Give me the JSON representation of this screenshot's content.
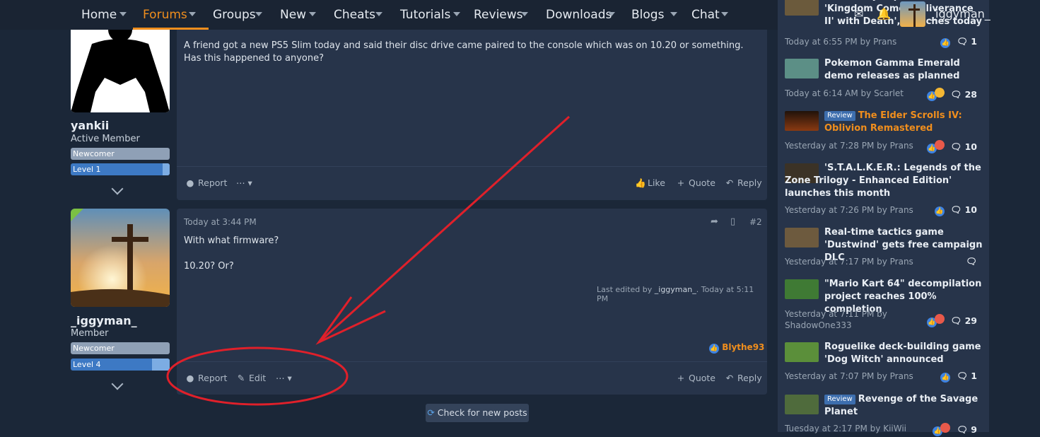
{
  "nav": {
    "items": [
      {
        "label": "Home"
      },
      {
        "label": "Forums"
      },
      {
        "label": "Groups"
      },
      {
        "label": "New"
      },
      {
        "label": "Cheats"
      },
      {
        "label": "Tutorials"
      },
      {
        "label": "Reviews"
      },
      {
        "label": "Downloads"
      },
      {
        "label": "Blogs"
      },
      {
        "label": "Chat"
      }
    ],
    "active": "Forums",
    "username": "_iggyman_"
  },
  "post1": {
    "author": {
      "name": "yankii",
      "title": "Active Member",
      "rank": "Newcomer",
      "level": "Level 1",
      "level_fill": 0.93
    },
    "text": "A friend got a new PS5 Slim today and said their disc drive came paired to the console which was on 10.20 or something. Has this happened to anyone?",
    "actions": {
      "report": "Report",
      "like": "Like",
      "quote": "Quote",
      "reply": "Reply"
    }
  },
  "post2": {
    "author": {
      "name": "_iggyman_",
      "title": "Member",
      "rank": "Newcomer",
      "level": "Level 4",
      "level_fill": 0.82
    },
    "date": "Today at 3:44 PM",
    "number": "#2",
    "line1": "With what firmware?",
    "line2": "10.20? Or?",
    "edited_prefix": "Last edited by ",
    "edited_user": "_iggyman_",
    "edited_time": ". Today at 5:11 PM",
    "reaction_user": "Blythe93",
    "actions": {
      "report": "Report",
      "edit": "Edit",
      "quote": "Quote",
      "reply": "Reply"
    }
  },
  "check_new_posts": "Check for new posts",
  "sidebar": {
    "items": [
      {
        "title": "First story expansion for 'Kingdom Come: Deliverance II' with Death', launches today",
        "meta": "Today at 6:55 PM by Prans",
        "count": "1"
      },
      {
        "title": "Pokemon Gamma Emerald demo releases as planned",
        "meta": "Today at 6:14 AM by Scarlet",
        "count": "28"
      },
      {
        "badge": "Review",
        "title": "The Elder Scrolls IV: Oblivion Remastered",
        "meta": "Yesterday at 7:28 PM by Prans",
        "count": "10"
      },
      {
        "title": "'S.T.A.L.K.E.R.: Legends of the Zone Trilogy - Enhanced Edition' launches this month",
        "meta": "Yesterday at 7:26 PM by Prans",
        "count": "10"
      },
      {
        "title": "Real-time tactics game 'Dustwind' gets free campaign DLC",
        "meta": "Yesterday at 7:17 PM by Prans",
        "count": ""
      },
      {
        "title": "\"Mario Kart 64\" decompilation project reaches 100% completion",
        "meta_line1": "Yesterday at 7:11 PM by",
        "meta_line2": "ShadowOne333",
        "count": "29"
      },
      {
        "title": "Roguelike deck-building game 'Dog Witch' announced",
        "meta": "Yesterday at 7:07 PM by Prans",
        "count": "1"
      },
      {
        "badge": "Review",
        "title": "Revenge of the Savage Planet",
        "meta": "Tuesday at 2:17 PM by KiiWii",
        "count": "9"
      }
    ]
  },
  "colors": {
    "accent": "#f08e1d",
    "annotation": "#e0202a",
    "bg": "#1b2738",
    "panel": "#27344a"
  }
}
